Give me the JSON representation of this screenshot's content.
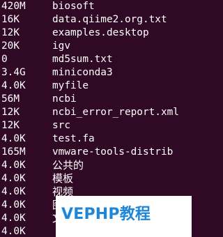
{
  "terminal": {
    "listing": [
      {
        "size": "420M",
        "name": "biosoft"
      },
      {
        "size": "16K",
        "name": "data.qiime2.org.txt"
      },
      {
        "size": "12K",
        "name": "examples.desktop"
      },
      {
        "size": "20K",
        "name": "igv"
      },
      {
        "size": "0",
        "name": "md5sum.txt"
      },
      {
        "size": "3.4G",
        "name": "miniconda3"
      },
      {
        "size": "4.0K",
        "name": "myfile"
      },
      {
        "size": "56M",
        "name": "ncbi"
      },
      {
        "size": "12K",
        "name": "ncbi_error_report.xml"
      },
      {
        "size": "12K",
        "name": "src"
      },
      {
        "size": "4.0K",
        "name": "test.fa"
      },
      {
        "size": "165M",
        "name": "vmware-tools-distrib"
      },
      {
        "size": "4.0K",
        "name": "公共的"
      },
      {
        "size": "4.0K",
        "name": "模板"
      },
      {
        "size": "4.0K",
        "name": "视频"
      },
      {
        "size": "4.0K",
        "name": "图片"
      },
      {
        "size": "4.0K",
        "name": "文档"
      },
      {
        "size": "4.0K",
        "name": ""
      }
    ]
  },
  "watermark": {
    "text": "VEPHP教程"
  },
  "colors": {
    "terminal_background": "#300a24",
    "terminal_text": "#ffffff",
    "watermark_background": "#ffffff",
    "watermark_text": "#1f86d7"
  }
}
